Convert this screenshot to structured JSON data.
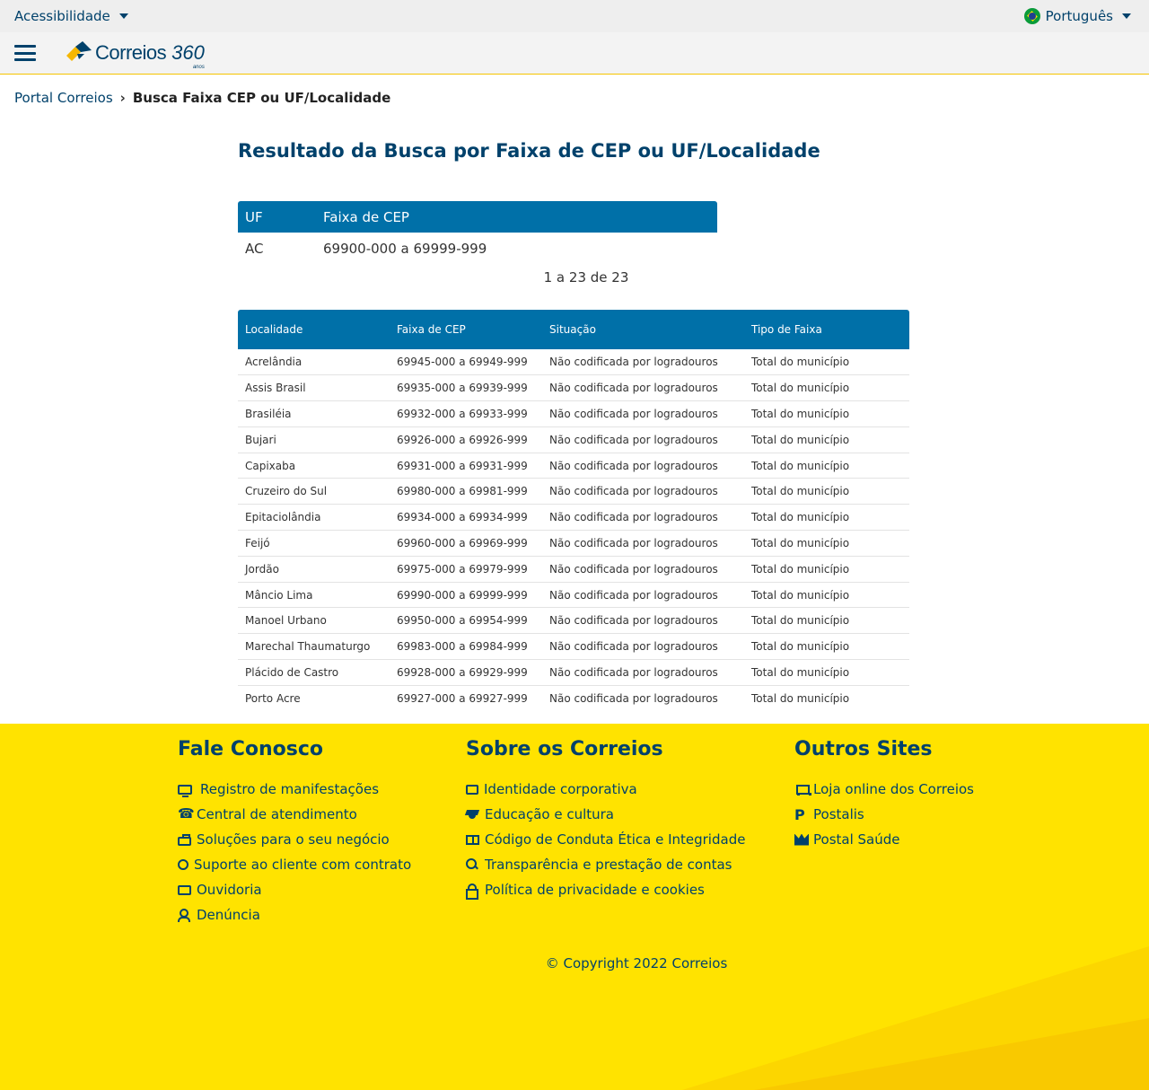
{
  "topbar": {
    "accessibility": "Acessibilidade",
    "language": "Português"
  },
  "header": {
    "logo_text": "Correios",
    "logo_360": "360",
    "logo_anos": "anos"
  },
  "breadcrumb": {
    "home": "Portal Correios",
    "separator": "›",
    "current": "Busca Faixa CEP ou UF/Localidade"
  },
  "main": {
    "title": "Resultado da Busca por Faixa de CEP ou UF/Localidade",
    "uf_table": {
      "headers": [
        "UF",
        "Faixa de CEP"
      ],
      "row": [
        "AC",
        "69900-000 a 69999-999"
      ]
    },
    "pagination": "1 a 23 de 23",
    "loc_table": {
      "headers": [
        "Localidade",
        "Faixa de CEP",
        "Situação",
        "Tipo de Faixa"
      ],
      "rows": [
        [
          "Acrelândia",
          "69945-000 a 69949-999",
          "Não codificada por logradouros",
          "Total do município"
        ],
        [
          "Assis Brasil",
          "69935-000 a 69939-999",
          "Não codificada por logradouros",
          "Total do município"
        ],
        [
          "Brasiléia",
          "69932-000 a 69933-999",
          "Não codificada por logradouros",
          "Total do município"
        ],
        [
          "Bujari",
          "69926-000 a 69926-999",
          "Não codificada por logradouros",
          "Total do município"
        ],
        [
          "Capixaba",
          "69931-000 a 69931-999",
          "Não codificada por logradouros",
          "Total do município"
        ],
        [
          "Cruzeiro do Sul",
          "69980-000 a 69981-999",
          "Não codificada por logradouros",
          "Total do município"
        ],
        [
          "Epitaciolândia",
          "69934-000 a 69934-999",
          "Não codificada por logradouros",
          "Total do município"
        ],
        [
          "Feijó",
          "69960-000 a 69969-999",
          "Não codificada por logradouros",
          "Total do município"
        ],
        [
          "Jordão",
          "69975-000 a 69979-999",
          "Não codificada por logradouros",
          "Total do município"
        ],
        [
          "Mâncio Lima",
          "69990-000 a 69999-999",
          "Não codificada por logradouros",
          "Total do município"
        ],
        [
          "Manoel Urbano",
          "69950-000 a 69954-999",
          "Não codificada por logradouros",
          "Total do município"
        ],
        [
          "Marechal Thaumaturgo",
          "69983-000 a 69984-999",
          "Não codificada por logradouros",
          "Total do município"
        ],
        [
          "Plácido de Castro",
          "69928-000 a 69929-999",
          "Não codificada por logradouros",
          "Total do município"
        ],
        [
          "Porto Acre",
          "69927-000 a 69927-999",
          "Não codificada por logradouros",
          "Total do município"
        ]
      ]
    }
  },
  "footer": {
    "col1": {
      "title": "Fale Conosco",
      "items": [
        {
          "label": "Registro de manifestações",
          "icon": "monitor-icon"
        },
        {
          "label": "Central de atendimento",
          "icon": "phone-icon"
        },
        {
          "label": "Soluções para o seu negócio",
          "icon": "briefcase-icon"
        },
        {
          "label": "Suporte ao cliente com contrato",
          "icon": "refresh-icon"
        },
        {
          "label": "Ouvidoria",
          "icon": "chat-icon"
        },
        {
          "label": "Denúncia",
          "icon": "user-icon"
        }
      ]
    },
    "col2": {
      "title": "Sobre os Correios",
      "items": [
        {
          "label": "Identidade corporativa",
          "icon": "id-card-icon"
        },
        {
          "label": "Educação e cultura",
          "icon": "graduation-cap-icon"
        },
        {
          "label": "Código de Conduta Ética e Integridade",
          "icon": "book-icon"
        },
        {
          "label": "Transparência e prestação de contas",
          "icon": "search-icon"
        },
        {
          "label": "Política de privacidade e cookies",
          "icon": "lock-icon"
        }
      ]
    },
    "col3": {
      "title": "Outros Sites",
      "items": [
        {
          "label": "Loja online dos Correios",
          "icon": "cart-icon"
        },
        {
          "label": "Postalis",
          "icon": "postalis-icon"
        },
        {
          "label": "Postal Saúde",
          "icon": "postal-saude-icon"
        }
      ]
    },
    "copyright": "© Copyright 2022 Correios"
  },
  "colors": {
    "brand_blue": "#00416b",
    "table_header": "#0070a8",
    "footer_yellow": "#ffe300"
  }
}
